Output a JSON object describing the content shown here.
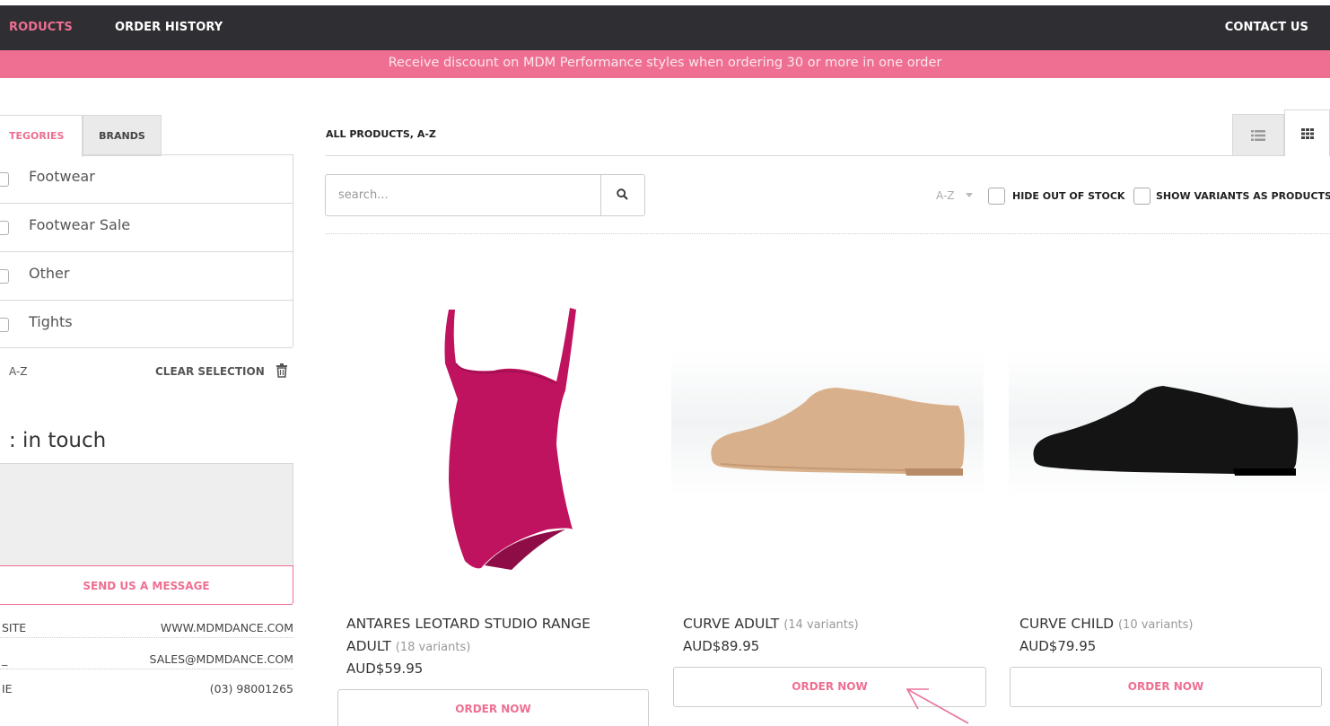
{
  "nav": {
    "products": "RODUCTS",
    "order_history": "ORDER HISTORY",
    "contact": "CONTACT US"
  },
  "banner": "Receive discount on MDM Performance styles when ordering 30 or more in one order",
  "sidebar": {
    "tabs": {
      "categories": "TEGORIES",
      "brands": "BRANDS"
    },
    "categories": [
      {
        "label": "Footwear"
      },
      {
        "label": "Footwear Sale"
      },
      {
        "label": "Other"
      },
      {
        "label": "Tights"
      }
    ],
    "sort_label": "A-Z",
    "clear_selection": "CLEAR SELECTION",
    "get_in_touch": ": in touch",
    "send_message": "SEND US A MESSAGE",
    "contact_rows": [
      {
        "label": "SITE",
        "value": "WWW.MDMDANCE.COM"
      },
      {
        "label": "_",
        "value": "SALES@MDMDANCE.COM"
      },
      {
        "label": "IE",
        "value": "(03) 98001265"
      }
    ]
  },
  "main": {
    "breadcrumb": "ALL PRODUCTS, A-Z",
    "search": {
      "placeholder": "search...",
      "value": ""
    },
    "sort_value": "A-Z",
    "hide_out_of_stock": "HIDE OUT OF STOCK",
    "show_variants": "SHOW VARIANTS AS PRODUCTS",
    "products": [
      {
        "name": "ANTARES LEOTARD STUDIO RANGE ADULT",
        "variants": "(18 variants)",
        "price": "AUD$59.95",
        "button": "ORDER NOW",
        "color": "#c0135f"
      },
      {
        "name": "CURVE ADULT",
        "variants": "(14 variants)",
        "price": "AUD$89.95",
        "button": "ORDER NOW",
        "color": "#d9b08c"
      },
      {
        "name": "CURVE CHILD",
        "variants": "(10 variants)",
        "price": "AUD$79.95",
        "button": "ORDER NOW",
        "color": "#141414"
      }
    ]
  },
  "colors": {
    "accent": "#ee6f92",
    "nav_bg": "#2f2f33"
  }
}
